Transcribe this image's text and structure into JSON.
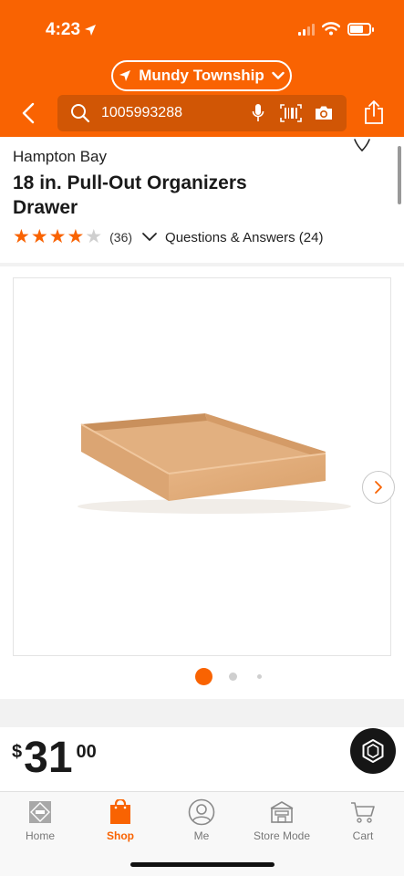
{
  "status_bar": {
    "time": "4:23"
  },
  "header": {
    "location": "Mundy Township",
    "search_value": "1005993288"
  },
  "product": {
    "brand": "Hampton Bay",
    "title": "18 in. Pull-Out Organizers Drawer",
    "rating": 4,
    "rating_max": 5,
    "review_count": "(36)",
    "qa_label": "Questions & Answers (24)"
  },
  "gallery": {
    "active_index": 1,
    "count": 3
  },
  "price": {
    "currency": "$",
    "dollars": "31",
    "cents": "00"
  },
  "tabbar": {
    "tabs": [
      {
        "label": "Home",
        "icon": "home-depot-logo-icon"
      },
      {
        "label": "Shop",
        "icon": "shop-bag-icon"
      },
      {
        "label": "Me",
        "icon": "person-icon"
      },
      {
        "label": "Store Mode",
        "icon": "store-icon"
      },
      {
        "label": "Cart",
        "icon": "cart-icon"
      }
    ],
    "active": "Shop"
  },
  "colors": {
    "brand_orange": "#f96302",
    "search_bg": "#d15605"
  }
}
